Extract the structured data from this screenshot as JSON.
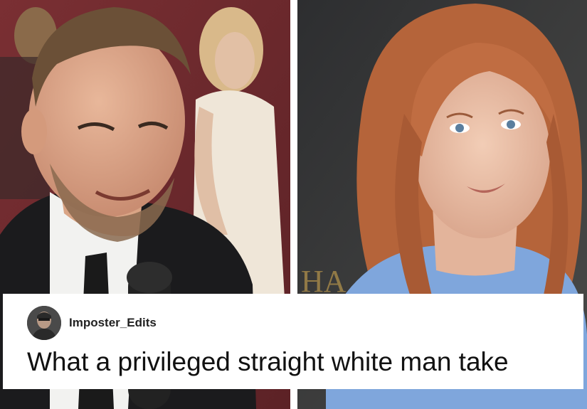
{
  "photos": {
    "left": {
      "subject": "man-in-suit-photo"
    },
    "right": {
      "subject": "woman-red-hair-photo"
    }
  },
  "comment": {
    "username": "Imposter_Edits",
    "text": "What a privileged straight white man take"
  }
}
